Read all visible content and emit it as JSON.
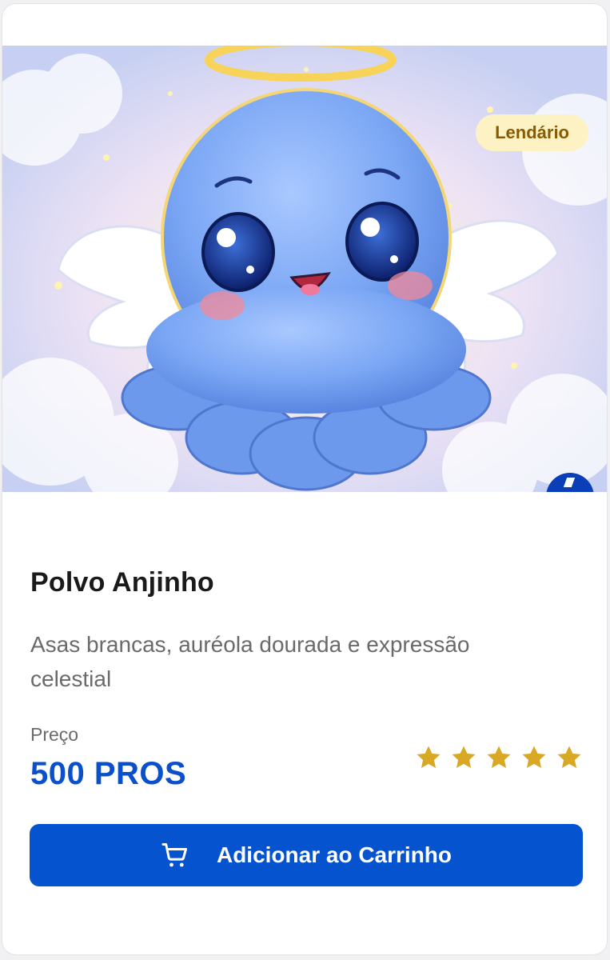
{
  "product": {
    "rarity_badge": "Lendário",
    "name": "Polvo Anjinho",
    "description": "Asas brancas, auréola dourada e expressão celestial",
    "price_label": "Preço",
    "price_value": "500 PROS",
    "rating_stars": 5,
    "image_icon": "angel-octopus-illustration"
  },
  "actions": {
    "add_to_cart_label": "Adicionar ao Carrinho",
    "add_to_cart_icon": "shopping-cart-icon"
  },
  "colors": {
    "accent": "#0653cf",
    "price": "#0a4fcc",
    "badge_background": "#fdf2c4",
    "badge_text": "#8a5a00",
    "star": "#d9a825"
  }
}
